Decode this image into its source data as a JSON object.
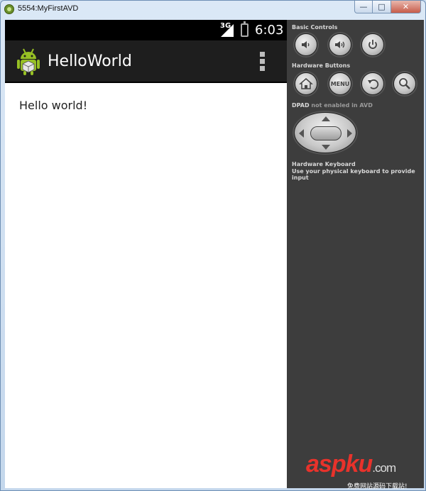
{
  "window": {
    "title": "5554:MyFirstAVD",
    "minimize": "—",
    "maximize": "□",
    "close": "✕"
  },
  "device": {
    "status_bar": {
      "network": "3G",
      "time": "6:03"
    },
    "action_bar": {
      "app_title": "HelloWorld"
    },
    "content": {
      "text": "Hello world!"
    }
  },
  "controls": {
    "basic_controls_label": "Basic Controls",
    "hardware_buttons_label": "Hardware Buttons",
    "menu_button": "MENU",
    "dpad_label": "DPAD",
    "dpad_note": "not enabled in AVD",
    "hardware_keyboard_label": "Hardware Keyboard",
    "hardware_keyboard_note": "Use your physical keyboard to provide input"
  },
  "watermark": {
    "logo": "aspku",
    "domain": ".com",
    "tagline": "免费网站源码下载站!"
  },
  "colors": {
    "action_bar": "#1e1e1e",
    "panel": "#3d3d3d",
    "android_green": "#97c024",
    "watermark_red": "#e8322b"
  },
  "icons": [
    "volume-down-icon",
    "volume-up-icon",
    "power-icon",
    "home-icon",
    "back-icon",
    "search-icon",
    "android-icon",
    "overflow-menu-icon",
    "signal-icon",
    "battery-icon"
  ]
}
